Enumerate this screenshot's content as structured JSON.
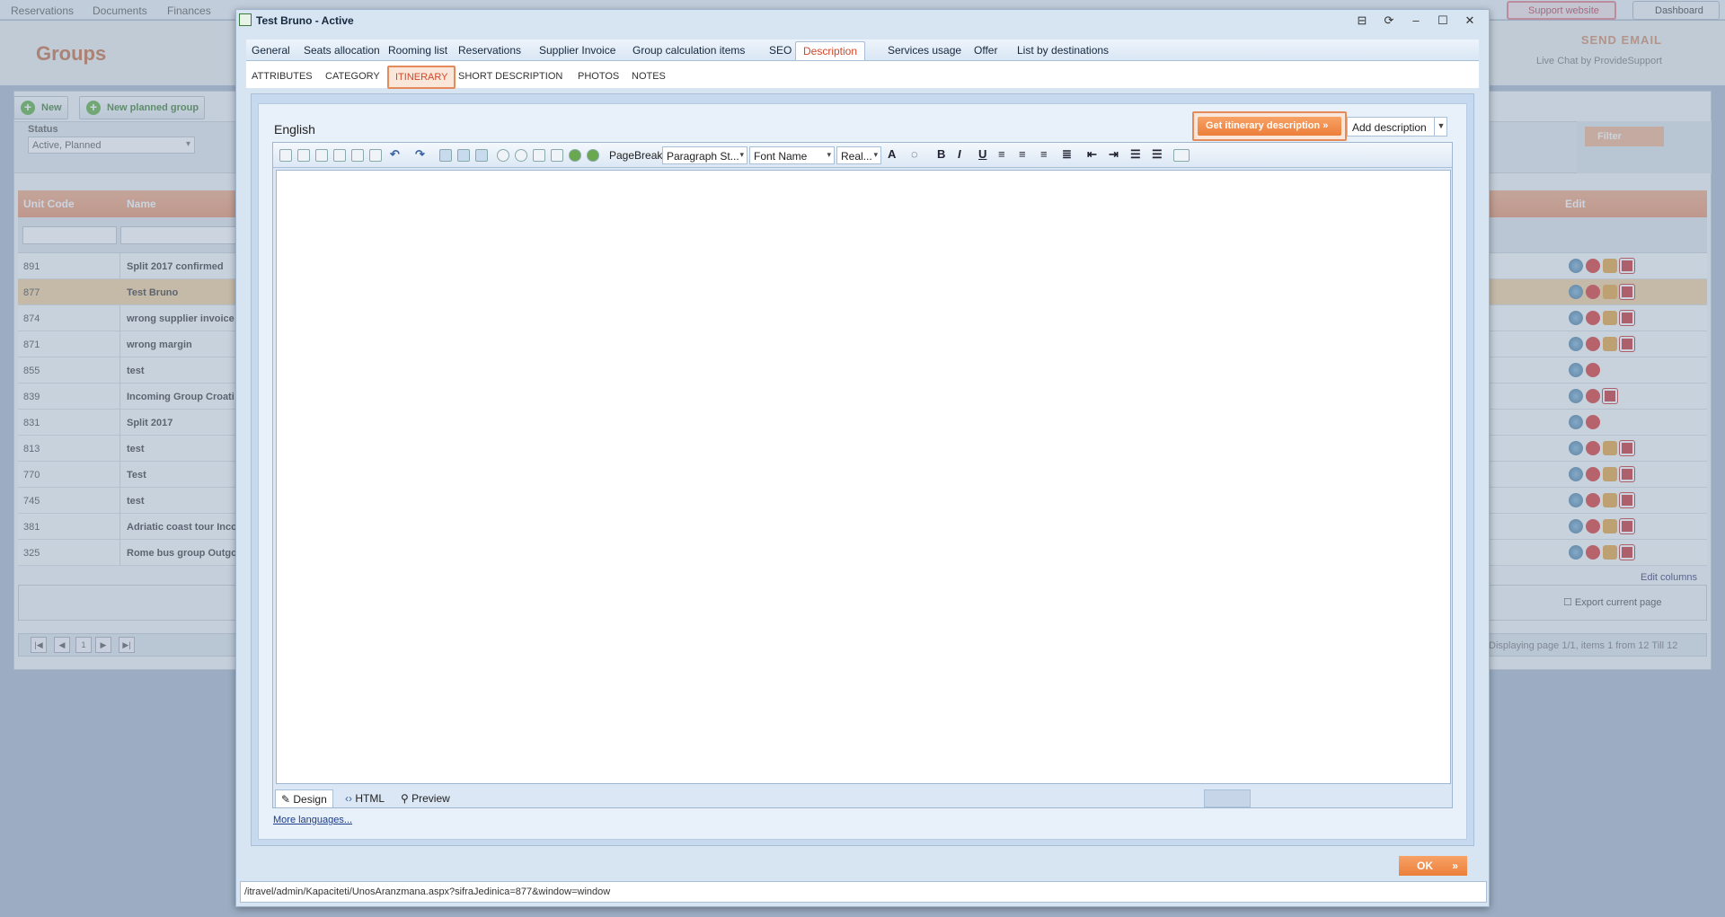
{
  "app": {
    "top_menu": [
      "Reservations",
      "Documents",
      "Finances"
    ],
    "page_title": "Groups",
    "send_email": "SEND EMAIL",
    "live_chat": "Live Chat by ProvideSupport",
    "support_website": "Support website",
    "dashboard": "Dashboard",
    "toolbar": {
      "new": "New",
      "new_planned_group": "New planned group"
    },
    "status": {
      "label": "Status",
      "value": "Active, Planned"
    },
    "filter": "Filter",
    "grid": {
      "columns": {
        "unit_code": "Unit Code",
        "name": "Name",
        "edit": "Edit"
      },
      "rows": [
        {
          "code": "891",
          "name": "Split 2017 confirmed",
          "icons": 4
        },
        {
          "code": "877",
          "name": "Test Bruno",
          "icons": 4,
          "selected": true
        },
        {
          "code": "874",
          "name": "wrong supplier invoice",
          "icons": 4
        },
        {
          "code": "871",
          "name": "wrong margin",
          "icons": 4
        },
        {
          "code": "855",
          "name": "test",
          "icons": 2
        },
        {
          "code": "839",
          "name": "Incoming Group Croati",
          "icons": 3
        },
        {
          "code": "831",
          "name": "Split 2017",
          "icons": 2
        },
        {
          "code": "813",
          "name": "test",
          "icons": 4
        },
        {
          "code": "770",
          "name": "Test",
          "icons": 4
        },
        {
          "code": "745",
          "name": "test",
          "icons": 4
        },
        {
          "code": "381",
          "name": "Adriatic coast tour Inco",
          "icons": 4
        },
        {
          "code": "325",
          "name": "Rome bus group Outgo",
          "icons": 4
        }
      ],
      "edit_columns": "Edit columns",
      "export_current_page": "Export current page",
      "pager_page": "1",
      "pager_info": "Displaying page 1/1, items 1 from 12 Till 12"
    }
  },
  "dialog": {
    "title": "Test Bruno - Active",
    "tabs": [
      "General",
      "Seats allocation",
      "Rooming list",
      "Reservations",
      "Supplier Invoice",
      "Group calculation items",
      "SEO",
      "Description",
      "Services usage",
      "Offer",
      "List by destinations"
    ],
    "active_tab": "Description",
    "subtabs": [
      "ATTRIBUTES",
      "CATEGORY",
      "ITINERARY",
      "SHORT DESCRIPTION",
      "PHOTOS",
      "NOTES"
    ],
    "active_subtab": "ITINERARY",
    "language": "English",
    "get_itinerary": "Get itinerary description",
    "add_description": "Add description",
    "editor": {
      "page_break": "PageBreak",
      "paragraph_style": "Paragraph St...",
      "font_name": "Font Name",
      "font_size": "Real...",
      "modes": [
        "Design",
        "HTML",
        "Preview"
      ]
    },
    "more_languages": "More languages...",
    "ok": "OK",
    "url": "/itravel/admin/Kapaciteti/UnosAranzmana.aspx?sifraJedinica=877&window=window"
  }
}
